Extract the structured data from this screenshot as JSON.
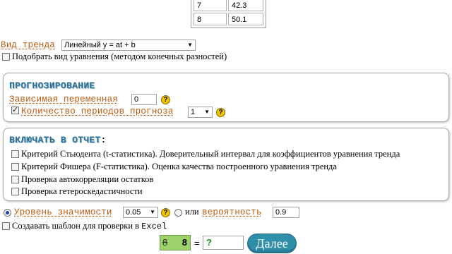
{
  "table": {
    "rows": [
      {
        "index": "7",
        "value": "42.3"
      },
      {
        "index": "8",
        "value": "50.1"
      }
    ]
  },
  "trend": {
    "label": "Вид тренда",
    "selected": "Линейный y = at + b",
    "fit_label": "Подобрать вид уравнения (методом конечных разностей)"
  },
  "forecast": {
    "title": "ПРОГНОЗИРОВАНИЕ",
    "dependent_label": "Зависимая переменная",
    "dependent_value": "0",
    "periods_label": "Количество периодов прогноза",
    "periods_value": "1"
  },
  "report": {
    "title": "ВКЛЮЧАТЬ В ОТЧЕТ",
    "title_suffix": ":",
    "items": [
      {
        "label": "Критерий Стьюдента (t-статистика). Доверительный интервал для коэффициентов уравнения тренда",
        "checked": false
      },
      {
        "label": "Критерий Фишера (F-статистика). Оценка качества построенного уравнения тренда",
        "checked": false
      },
      {
        "label": "Проверка автокорреляции остатков",
        "checked": false
      },
      {
        "label": "Проверка гетероскедастичности",
        "checked": false
      }
    ]
  },
  "significance": {
    "label": "Уровень значимости",
    "value": "0.05",
    "or_text": "или",
    "prob_label": "вероятность",
    "prob_value": "0.9"
  },
  "template": {
    "label_text": "Создавать шаблон для проверки в ",
    "label_mono": "Excel"
  },
  "captcha": {
    "num1": "8",
    "num2": "8",
    "eq": "=",
    "answer": "?"
  },
  "next_button": "Далее",
  "icons": {
    "help": "?",
    "dropdown": "▼"
  },
  "colors": {
    "accent": "#2c6e92",
    "label_orange": "#c05a10",
    "help_yellow": "#f2c400",
    "button_teal": "#2f8fa8"
  }
}
